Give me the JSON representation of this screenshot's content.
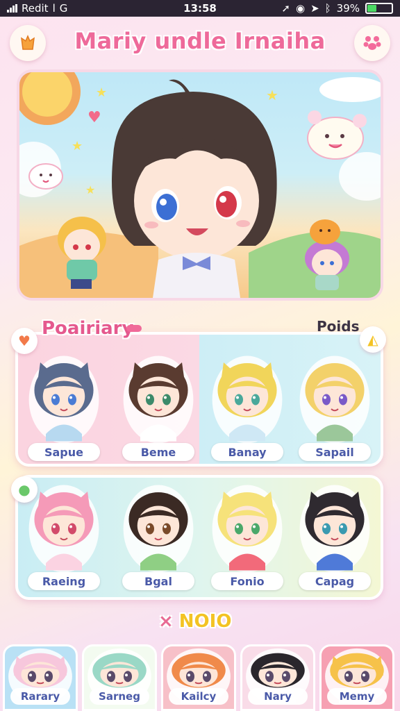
{
  "status_bar": {
    "carrier": "Redit",
    "carrier_suffix": "l",
    "time": "13:58",
    "battery_text": "39%",
    "battery_level": 0.39
  },
  "header": {
    "title": "Mariy undle Irnaiha",
    "left_icon": "star-badge-icon",
    "right_icon": "paw-icon"
  },
  "section_primary": {
    "label": "Poairiary",
    "right_label": "Poids",
    "left_icon": "heart-icon",
    "right_icon": "cheese-icon",
    "characters": [
      {
        "name": "Sapue",
        "hair": "#5a6b8e",
        "eyes": "#4a7bd4",
        "ears": true,
        "shirt": "#b7d9f0"
      },
      {
        "name": "Beme",
        "hair": "#5a3b30",
        "eyes": "#3c8a6a",
        "ears": true,
        "shirt": "#ffffff"
      },
      {
        "name": "Banay",
        "hair": "#f1d55a",
        "eyes": "#4aa89a",
        "ears": true,
        "shirt": "#cfe8f5"
      },
      {
        "name": "Sapail",
        "hair": "#f3d16a",
        "eyes": "#7a5ac8",
        "ears": false,
        "shirt": "#9bc79a"
      }
    ]
  },
  "section_secondary": {
    "left_icon": "frog-icon",
    "characters": [
      {
        "name": "Raeing",
        "hair": "#f59ab8",
        "eyes": "#d24a6a",
        "ears": true,
        "shirt": "#fbd3e2"
      },
      {
        "name": "Bgal",
        "hair": "#3b2a24",
        "eyes": "#7a4a2a",
        "ears": false,
        "shirt": "#8fcf84"
      },
      {
        "name": "Fonio",
        "hair": "#f6e27a",
        "eyes": "#4aa86a",
        "ears": true,
        "shirt": "#f26a7a"
      },
      {
        "name": "Capag",
        "hair": "#2f2a30",
        "eyes": "#3a9ab0",
        "ears": true,
        "shirt": "#4f7ad8"
      }
    ]
  },
  "bottom": {
    "title": "NOIO",
    "title_prefix": "×",
    "tabs": [
      {
        "name": "Rarary",
        "bg": "#b9e1f5",
        "hair": "#f7c7dc",
        "creature": true
      },
      {
        "name": "Sarneg",
        "bg": "#f3fbf0",
        "hair": "#9ad8c6",
        "creature": false
      },
      {
        "name": "Kailcy",
        "bg": "#f7c0c8",
        "hair": "#f08a4a",
        "creature": false
      },
      {
        "name": "Nary",
        "bg": "#f9dce8",
        "hair": "#2a262c",
        "creature": false
      },
      {
        "name": "Memy",
        "bg": "#f6a0b2",
        "hair": "#f6c24a",
        "creature": true
      }
    ]
  },
  "colors": {
    "accent": "#ee6a9a",
    "gold": "#f3c324"
  }
}
